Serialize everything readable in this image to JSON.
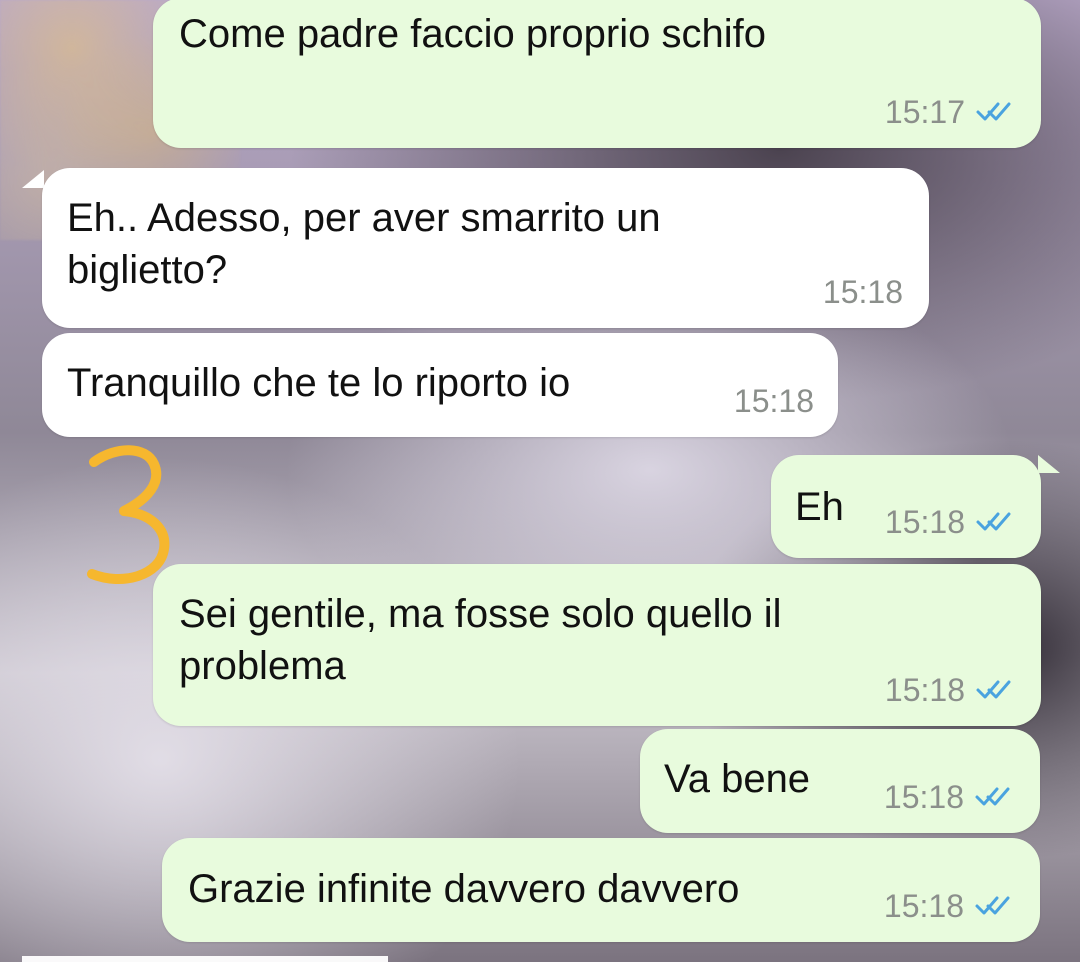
{
  "messages": [
    {
      "text": "Come padre faccio proprio schifo",
      "time": "15:17"
    },
    {
      "text": "Eh.. Adesso, per aver smarrito un\nbiglietto?",
      "time": "15:18"
    },
    {
      "text": "Tranquillo che te lo riporto io",
      "time": "15:18"
    },
    {
      "text": "Eh",
      "time": "15:18"
    },
    {
      "text": "Sei gentile, ma fosse solo quello il\nproblema",
      "time": "15:18"
    },
    {
      "text": "Va bene",
      "time": "15:18"
    },
    {
      "text": "Grazie infinite davvero davvero",
      "time": "15:18"
    }
  ],
  "annotation": {
    "label": "3"
  },
  "colors": {
    "outgoing_bubble": "#e8fbdd",
    "incoming_bubble": "#ffffff",
    "read_ticks": "#4aa3df",
    "annotation": "#f6b72e"
  }
}
